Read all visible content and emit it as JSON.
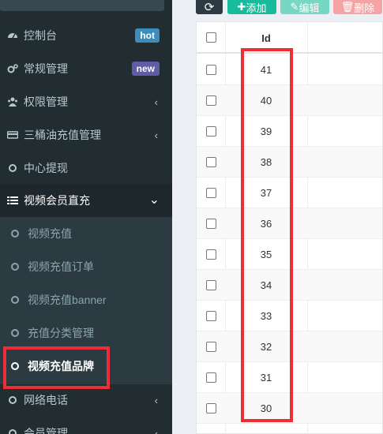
{
  "sidebar": {
    "items": [
      {
        "label": "控制台",
        "badge": "hot",
        "badge_color": "#3c8dbc"
      },
      {
        "label": "常规管理",
        "badge": "new",
        "badge_color": "#605ca8"
      },
      {
        "label": "权限管理",
        "chevron": "‹"
      },
      {
        "label": "三桶油充值管理",
        "chevron": "‹"
      },
      {
        "label": "中心提现"
      },
      {
        "label": "视频会员直充",
        "chevron": "⌄"
      },
      {
        "label": "网络电话",
        "chevron": "‹"
      },
      {
        "label": "会员管理",
        "chevron": "‹"
      }
    ],
    "subitems": [
      {
        "label": "视频充值"
      },
      {
        "label": "视频充值订单"
      },
      {
        "label": "视频充值banner"
      },
      {
        "label": "充值分类管理"
      },
      {
        "label": "视频充值品牌"
      }
    ]
  },
  "toolbar": {
    "refresh_color": "#2c3b41",
    "add_label": "添加",
    "add_color": "#18bc9c",
    "edit_label": "编辑",
    "edit_color": "#76d7c4",
    "delete_label": "删除",
    "delete_color": "#f4a4a4"
  },
  "table": {
    "header_id": "Id",
    "ids": [
      "41",
      "40",
      "39",
      "38",
      "37",
      "36",
      "35",
      "34",
      "33",
      "32",
      "31",
      "30"
    ]
  },
  "highlight_color": "#ee2e36"
}
